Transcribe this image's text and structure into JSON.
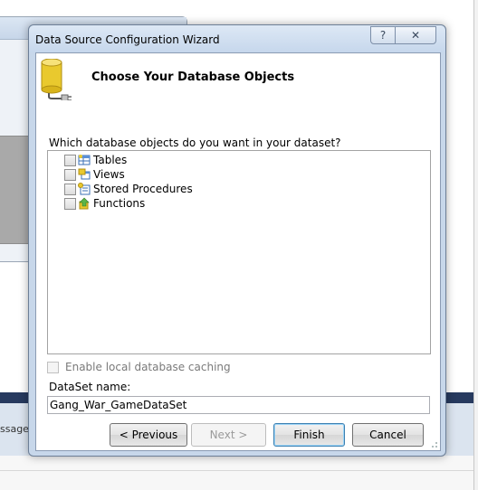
{
  "background": {
    "messages_fragment": "ssages"
  },
  "dialog": {
    "title": "Data Source Configuration Wizard",
    "help_glyph": "?",
    "close_glyph": "✕",
    "header_title": "Choose Your Database Objects",
    "question": "Which database objects do you want in your dataset?",
    "objects": [
      {
        "label": "Tables",
        "icon": "table-icon",
        "checked": false
      },
      {
        "label": "Views",
        "icon": "view-icon",
        "checked": false
      },
      {
        "label": "Stored Procedures",
        "icon": "stored-procedure-icon",
        "checked": false
      },
      {
        "label": "Functions",
        "icon": "function-icon",
        "checked": false
      }
    ],
    "cache_label": "Enable local database caching",
    "cache_enabled": false,
    "dataset_label": "DataSet name:",
    "dataset_value": "Gang_War_GameDataSet",
    "buttons": {
      "previous": "< Previous",
      "next": "Next >",
      "finish": "Finish",
      "cancel": "Cancel"
    }
  },
  "colors": {
    "dialog_frame": "#c7d7ea",
    "accent_bar": "#273a5f",
    "default_button_border": "#3c7fb1"
  }
}
